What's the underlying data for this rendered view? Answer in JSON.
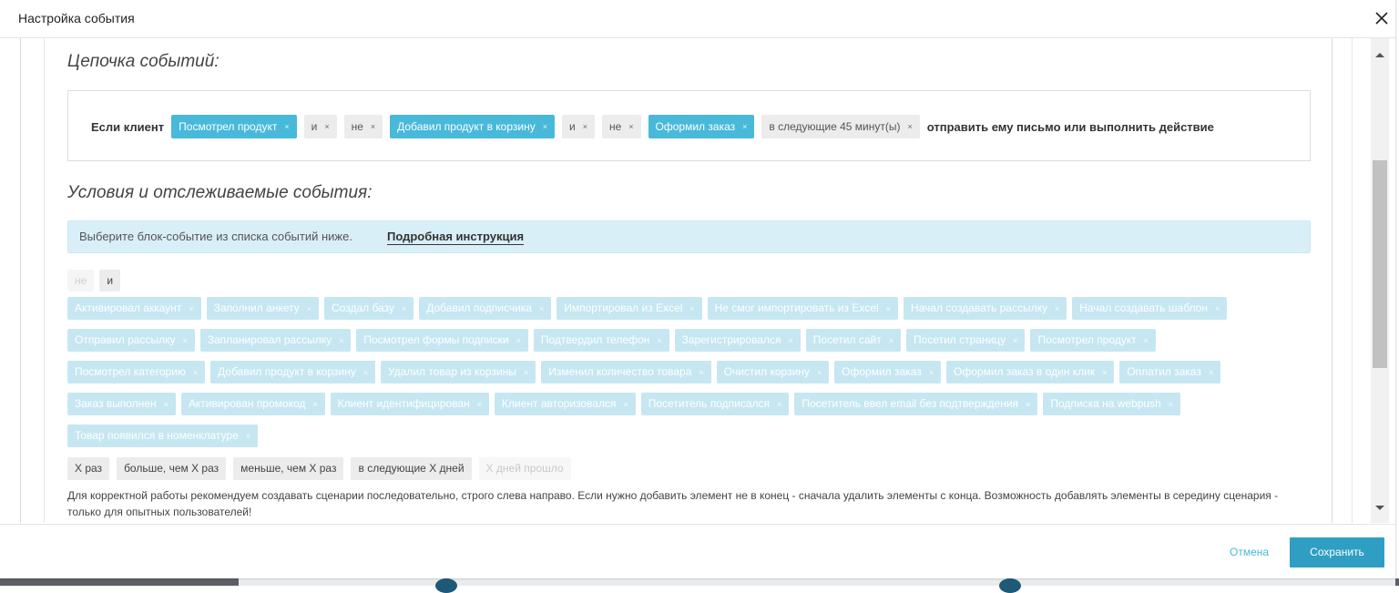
{
  "dialog": {
    "title": "Настройка события"
  },
  "chain": {
    "section_title": "Цепочка событий:",
    "lead": "Если клиент",
    "chips": [
      {
        "label": "Посмотрел продукт",
        "style": "blue"
      },
      {
        "label": "и",
        "style": "gray"
      },
      {
        "label": "не",
        "style": "gray"
      },
      {
        "label": "Добавил продукт в корзину",
        "style": "blue"
      },
      {
        "label": "и",
        "style": "gray"
      },
      {
        "label": "не",
        "style": "gray"
      },
      {
        "label": "Оформил заказ",
        "style": "blue"
      },
      {
        "label": "в следующие 45 минут(ы)",
        "style": "gray"
      }
    ],
    "tail": "отправить ему письмо или выполнить действие",
    "remove_glyph": "×"
  },
  "conditions": {
    "section_title": "Условия и отслеживаемые события:",
    "info_text": "Выберите блок-событие из списка событий ниже.",
    "info_link": "Подробная инструкция",
    "operators": [
      {
        "label": "не",
        "enabled": false
      },
      {
        "label": "и",
        "enabled": true
      }
    ],
    "event_rows": [
      [
        "Активировал аккаунт",
        "Заполнил анкету",
        "Создал базу",
        "Добавил подписчика",
        "Импортировал из Excel",
        "Не смог импортировать из Excel",
        "Начал создавать рассылку",
        "Начал создавать шаблон"
      ],
      [
        "Отправил рассылку",
        "Запланировал рассылку",
        "Посмотрел формы подписки",
        "Подтвердил телефон",
        "Зарегистрировался",
        "Посетил сайт",
        "Посетил страницу",
        "Посмотрел продукт"
      ],
      [
        "Посмотрел категорию",
        "Добавил продукт в корзину",
        "Удалил товар из корзины",
        "Изменил количество товара",
        "Очистил корзину",
        "Оформил заказ",
        "Оформил заказ в один клик",
        "Оплатил заказ"
      ],
      [
        "Заказ выполнен",
        "Активирован промокод",
        "Клиент идентифицирован",
        "Клиент авторизовался",
        "Посетитель подписался",
        "Посетитель ввел email без подтверждения",
        "Подписка на webpush"
      ],
      [
        "Товар появился в номенклатуре"
      ]
    ],
    "quantifiers": [
      {
        "label": "X раз",
        "enabled": true
      },
      {
        "label": "больше, чем X раз",
        "enabled": true
      },
      {
        "label": "меньше, чем X раз",
        "enabled": true
      },
      {
        "label": "в следующие X дней",
        "enabled": true
      },
      {
        "label": "X дней прошло",
        "enabled": false
      }
    ],
    "note": "Для корректной работы рекомендуем создавать сценарии последовательно, строго слева направо. Если нужно добавить элемент не в конец - сначала удалить элементы с конца. Возможность добавлять элементы в середину сценария - только для опытных пользователей!"
  },
  "footer": {
    "cancel_label": "Отмена",
    "save_label": "Сохранить"
  },
  "icons": {
    "close": "close-icon",
    "remove": "remove-icon"
  },
  "colors": {
    "accent": "#48b9d9",
    "save_button": "#2f9ec3",
    "info_bg": "#d9eff7",
    "event_tag": "#c6e7f1"
  }
}
